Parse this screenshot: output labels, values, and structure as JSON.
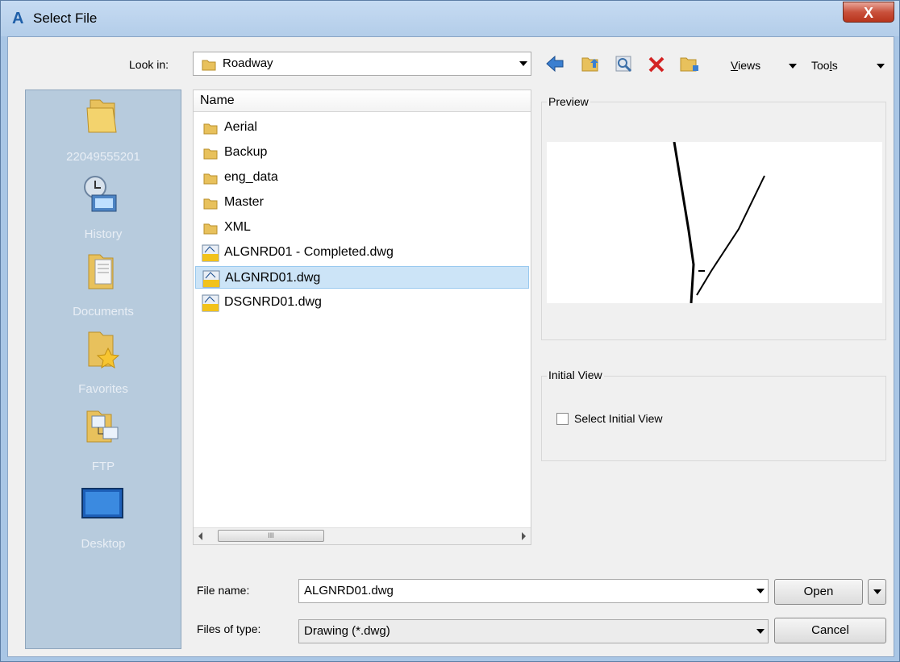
{
  "window": {
    "title": "Select File",
    "close_glyph": "X"
  },
  "lookin": {
    "label": "Look in:",
    "value": "Roadway"
  },
  "toolbar": {
    "views_label": "Views",
    "tools_label": "Tools"
  },
  "places": [
    {
      "label": "22049555201",
      "icon": "folder-icon"
    },
    {
      "label": "History",
      "icon": "history-icon"
    },
    {
      "label": "Documents",
      "icon": "documents-icon"
    },
    {
      "label": "Favorites",
      "icon": "favorites-icon"
    },
    {
      "label": "FTP",
      "icon": "ftp-icon"
    },
    {
      "label": "Desktop",
      "icon": "desktop-icon"
    }
  ],
  "filelist": {
    "header": "Name",
    "items": [
      {
        "name": "Aerial",
        "type": "folder"
      },
      {
        "name": "Backup",
        "type": "folder"
      },
      {
        "name": "eng_data",
        "type": "folder"
      },
      {
        "name": "Master",
        "type": "folder"
      },
      {
        "name": "XML",
        "type": "folder"
      },
      {
        "name": "ALGNRD01 - Completed.dwg",
        "type": "dwg"
      },
      {
        "name": "ALGNRD01.dwg",
        "type": "dwg",
        "selected": true
      },
      {
        "name": "DSGNRD01.dwg",
        "type": "dwg"
      }
    ],
    "scroll_grip": "III"
  },
  "preview": {
    "title": "Preview"
  },
  "initial_view": {
    "title": "Initial View",
    "checkbox_label": "Select Initial View",
    "checked": false
  },
  "filename": {
    "label": "File name:",
    "value": "ALGNRD01.dwg"
  },
  "filetype": {
    "label": "Files of type:",
    "value": "Drawing (*.dwg)"
  },
  "buttons": {
    "open": "Open",
    "cancel": "Cancel"
  },
  "colors": {
    "selection": "#cce4f7",
    "places_bg": "#b7cbdd",
    "accent": "#1f5fa8"
  }
}
